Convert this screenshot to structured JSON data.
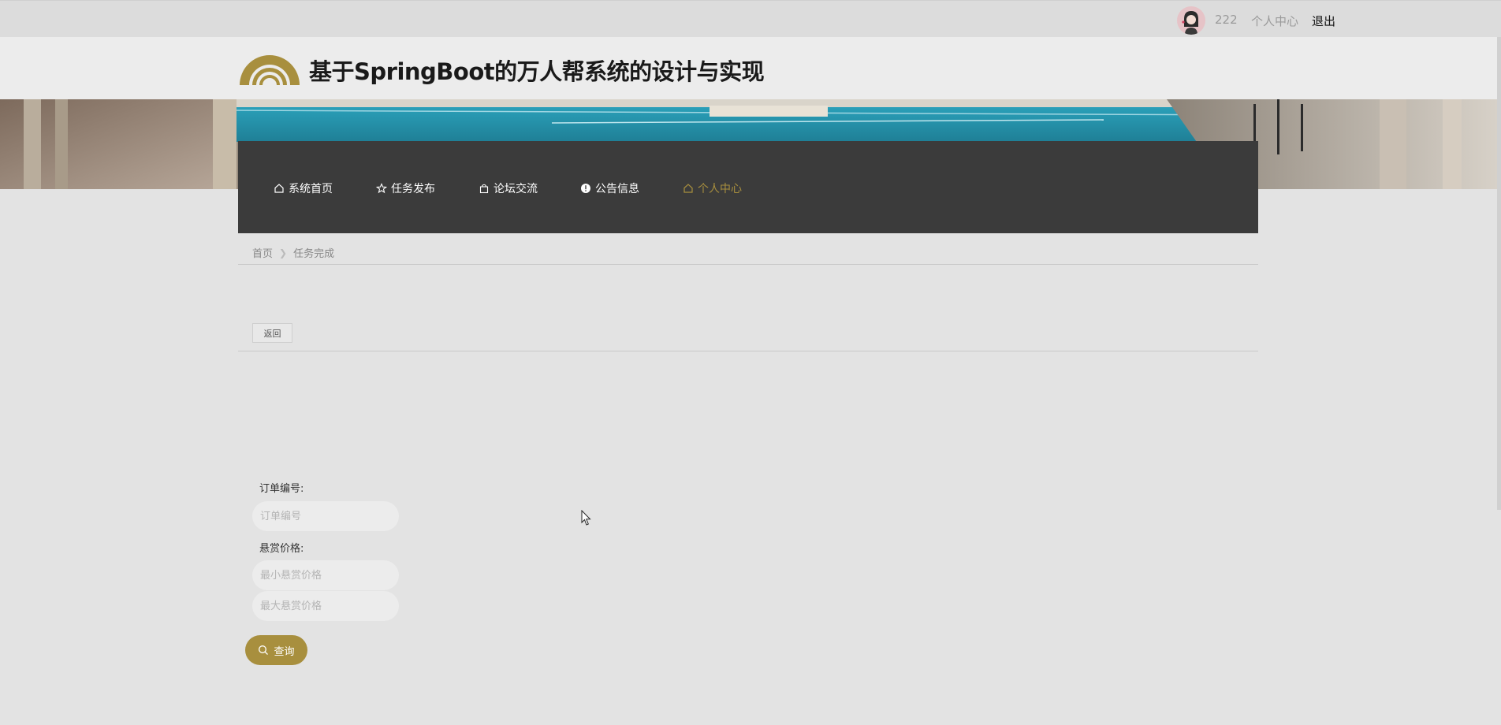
{
  "topbar": {
    "username": "222",
    "center_link": "个人中心",
    "logout": "退出"
  },
  "header": {
    "title": "基于SpringBoot的万人帮系统的设计与实现"
  },
  "nav": [
    {
      "label": "系统首页",
      "icon": "home-icon"
    },
    {
      "label": "任务发布",
      "icon": "star-icon"
    },
    {
      "label": "论坛交流",
      "icon": "bag-icon"
    },
    {
      "label": "公告信息",
      "icon": "info-icon"
    },
    {
      "label": "个人中心",
      "icon": "home-icon",
      "active": true
    }
  ],
  "breadcrumb": {
    "home": "首页",
    "current": "任务完成"
  },
  "back_label": "返回",
  "search": {
    "order_label": "订单编号:",
    "order_placeholder": "订单编号",
    "price_label": "悬赏价格:",
    "price_min_placeholder": "最小悬赏价格",
    "price_max_placeholder": "最大悬赏价格",
    "button_label": "查询"
  },
  "colors": {
    "accent": "#a88f3e",
    "nav_bg": "#3b3b3b",
    "page_bg": "#e3e3e3"
  }
}
